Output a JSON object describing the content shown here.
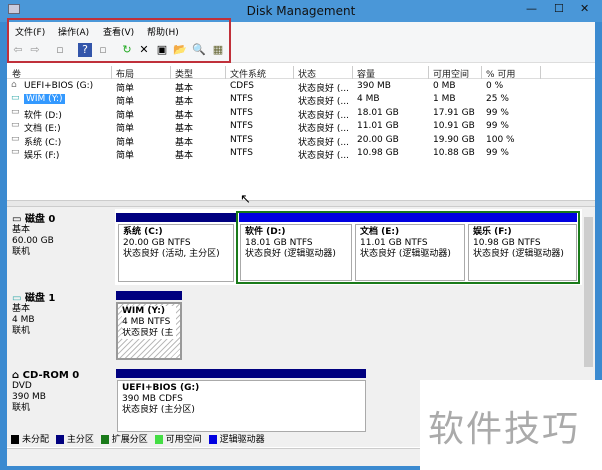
{
  "window": {
    "title": "Disk Management"
  },
  "menu": [
    "文件(F)",
    "操作(A)",
    "查看(V)",
    "帮助(H)"
  ],
  "columns": [
    "卷",
    "布局",
    "类型",
    "文件系统",
    "状态",
    "容量",
    "可用空间",
    "% 可用"
  ],
  "volumes": [
    [
      "UEFI+BIOS (G:)",
      "简单",
      "基本",
      "CDFS",
      "状态良好 (...",
      "390 MB",
      "0 MB",
      "0 %"
    ],
    [
      "WIM (Y:)",
      "简单",
      "基本",
      "NTFS",
      "状态良好 (...",
      "4 MB",
      "1 MB",
      "25 %"
    ],
    [
      "软件 (D:)",
      "简单",
      "基本",
      "NTFS",
      "状态良好 (...",
      "18.01 GB",
      "17.91 GB",
      "99 %"
    ],
    [
      "文档 (E:)",
      "简单",
      "基本",
      "NTFS",
      "状态良好 (...",
      "11.01 GB",
      "10.91 GB",
      "99 %"
    ],
    [
      "系统 (C:)",
      "简单",
      "基本",
      "NTFS",
      "状态良好 (...",
      "20.00 GB",
      "19.90 GB",
      "100 %"
    ],
    [
      "娱乐 (F:)",
      "简单",
      "基本",
      "NTFS",
      "状态良好 (...",
      "10.98 GB",
      "10.88 GB",
      "99 %"
    ]
  ],
  "disks": [
    {
      "name": "磁盘 0",
      "type": "基本",
      "size": "60.00 GB",
      "state": "联机"
    },
    {
      "name": "磁盘 1",
      "type": "基本",
      "size": "4 MB",
      "state": "联机"
    },
    {
      "name": "CD-ROM 0",
      "type": "DVD",
      "size": "390 MB",
      "state": "联机"
    }
  ],
  "partitions": [
    {
      "name": "系统 (C:)",
      "info": "20.00 GB NTFS",
      "status": "状态良好 (活动, 主分区)"
    },
    {
      "name": "软件 (D:)",
      "info": "18.01 GB NTFS",
      "status": "状态良好 (逻辑驱动器)"
    },
    {
      "name": "文档 (E:)",
      "info": "11.01 GB NTFS",
      "status": "状态良好 (逻辑驱动器)"
    },
    {
      "name": "娱乐 (F:)",
      "info": "10.98 GB NTFS",
      "status": "状态良好 (逻辑驱动器)"
    },
    {
      "name": "WIM (Y:)",
      "info": "4 MB NTFS",
      "status": "状态良好 (主"
    },
    {
      "name": "UEFI+BIOS (G:)",
      "info": "390 MB CDFS",
      "status": "状态良好 (主分区)"
    }
  ],
  "legend": [
    "未分配",
    "主分区",
    "扩展分区",
    "可用空间",
    "逻辑驱动器"
  ],
  "colors": {
    "primary": "#00007f",
    "logical": "#0000e0",
    "extended": "#1a7a1a",
    "free": "#44dd44",
    "unallocated": "#000000"
  },
  "watermark": "软件技巧"
}
